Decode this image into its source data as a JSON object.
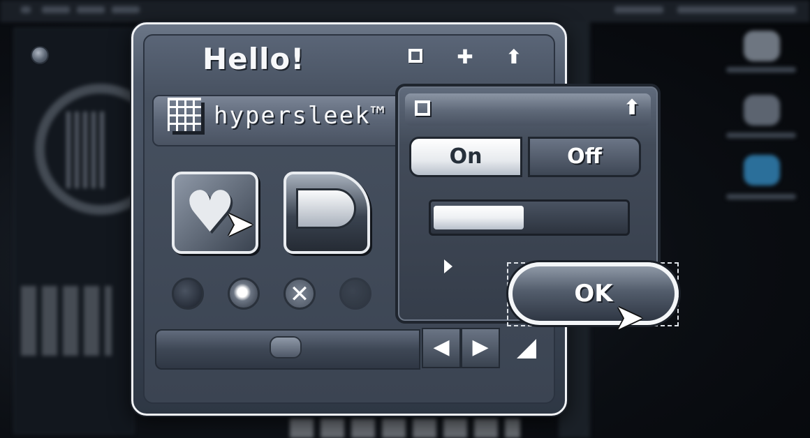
{
  "window": {
    "title": "Hello!"
  },
  "toolbar": {
    "label": "hypersleek™"
  },
  "panel": {
    "segmented": {
      "on_label": "On",
      "off_label": "Off",
      "selected": "On"
    },
    "progress_fraction": 0.47,
    "ok_label": "OK"
  },
  "radios": [
    {
      "state": "off"
    },
    {
      "state": "selected"
    },
    {
      "state": "close"
    },
    {
      "state": "disabled"
    }
  ],
  "icons": {
    "title_bar": [
      "square-icon",
      "plus-icon",
      "arrow-up-icon"
    ],
    "panel_title": [
      "square-icon",
      "arrow-up-icon"
    ],
    "big_buttons": [
      "heart-icon",
      "pill-toggle-icon"
    ],
    "nav": [
      "arrow-left-icon",
      "arrow-right-icon"
    ]
  },
  "colors": {
    "window_frame": "#f2f4f7",
    "surface": "#3b4452",
    "highlight": "#ffffff"
  }
}
